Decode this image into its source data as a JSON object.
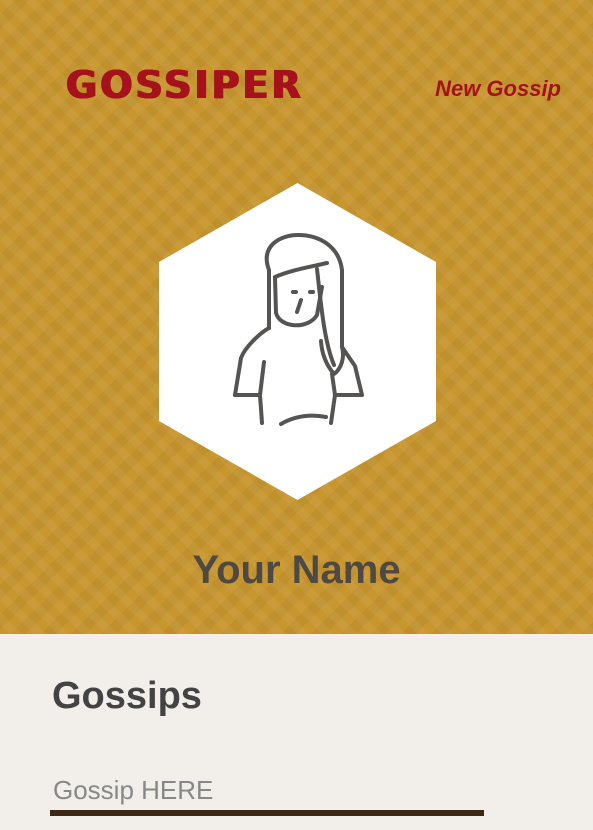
{
  "header": {
    "logo_text": "GOSSIPER",
    "new_gossip_label": "New Gossip"
  },
  "profile": {
    "avatar_icon": "woman-avatar-icon",
    "name": "Your Name"
  },
  "gossips": {
    "title": "Gossips",
    "input_placeholder": "Gossip HERE",
    "input_value": ""
  },
  "colors": {
    "brand_red": "#a5121b",
    "hero_gold": "#c8962f",
    "text_dark": "#4e4a43",
    "input_underline": "#3b2714",
    "page_background": "#f2efea"
  }
}
